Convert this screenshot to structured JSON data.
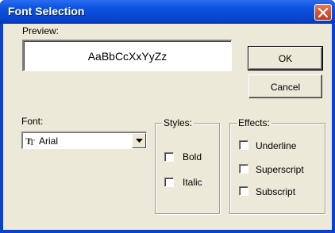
{
  "window": {
    "title": "Font Selection"
  },
  "preview": {
    "label": "Preview:",
    "sample_text": "AaBbCcXxYyZz"
  },
  "buttons": {
    "ok": "OK",
    "cancel": "Cancel"
  },
  "font": {
    "label": "Font:",
    "selected": "Arial",
    "icon": "truetype-font-icon"
  },
  "styles": {
    "title": "Styles:",
    "bold": "Bold",
    "italic": "Italic"
  },
  "effects": {
    "title": "Effects:",
    "underline": "Underline",
    "superscript": "Superscript",
    "subscript": "Subscript"
  }
}
